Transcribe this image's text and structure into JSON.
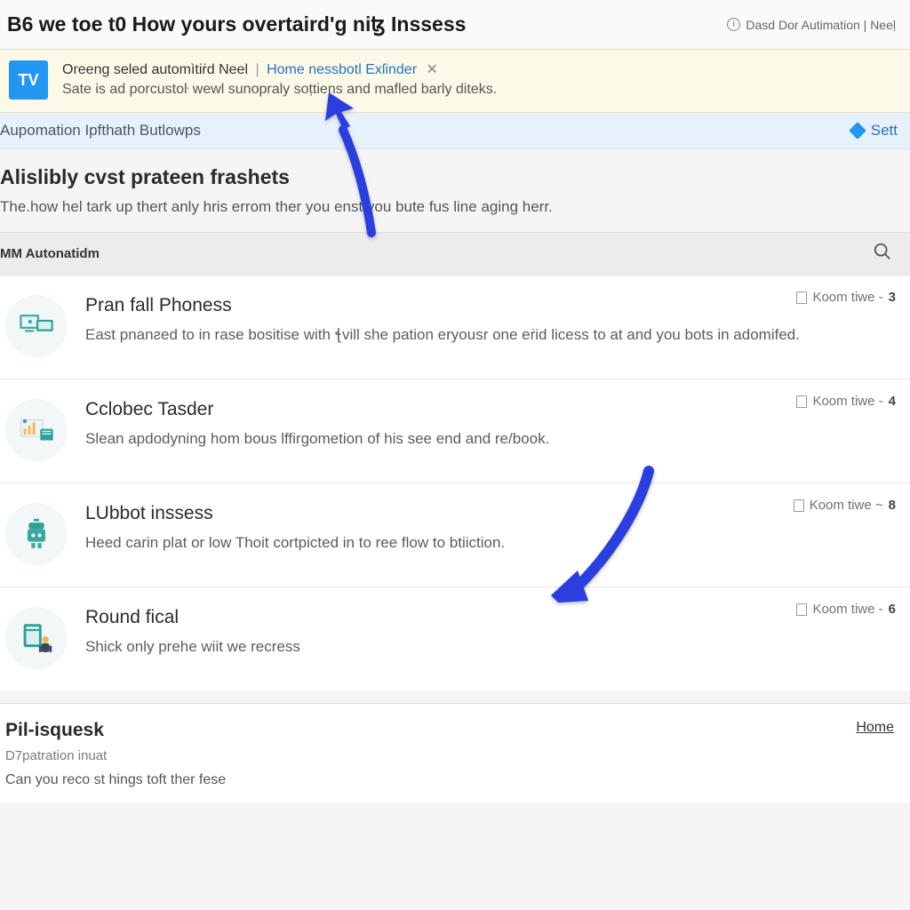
{
  "header": {
    "title": "B6 we toe t0 How yours overtaird'g nіꜩ Inssess",
    "right_label": "Dasd Dor Autimation | Neeḷ"
  },
  "banner": {
    "badge": "TV",
    "lead": "Oreeng seled automìtiṙd Neel",
    "link": "Home nessbotl Exſinder",
    "close_glyph": "✕",
    "sub": "Sate is ad porcustoŀ wewl sunopraly soṭtiens and mafled barly diteks."
  },
  "strip": {
    "label": "Aupomation Ipfthath Butlowps",
    "action": "Sett"
  },
  "intro": {
    "title": "Alislibly cvst prateen frashets",
    "sub": "The.how hel tark up thert anly hris errom ther you enst you bute fus line aging herr."
  },
  "tabs": {
    "active": "MM Autonatidm"
  },
  "items": [
    {
      "title": "Pran fall Phoness",
      "desc": "East pnanƨed to in rase bositise with ꞎvill she pation eryousr one eṙid licess to at and you bots in adomifed.",
      "meta_text": "Koom tiwe -",
      "meta_num": "3"
    },
    {
      "title": "Cclobec Tasder",
      "desc": "Slean apdodyning hom bous lffirgometion of his see end and re/book.",
      "meta_text": "Koom tiwe -",
      "meta_num": "4"
    },
    {
      "title": "LUbbot inssess",
      "desc": "Heed carin plat or low Thoit cortpicted in to ree flow to btiiction.",
      "meta_text": "Koom tiwe ~",
      "meta_num": "8"
    },
    {
      "title": "Round fical",
      "desc": "Shick only prehe wiit we recress",
      "meta_text": "Koom tiwe -",
      "meta_num": "6"
    }
  ],
  "footer": {
    "title": "Pil-isquesk",
    "sub1": "D7patration inuat",
    "sub2": "Can you reco st hings toft ther fese",
    "home": "Home"
  }
}
